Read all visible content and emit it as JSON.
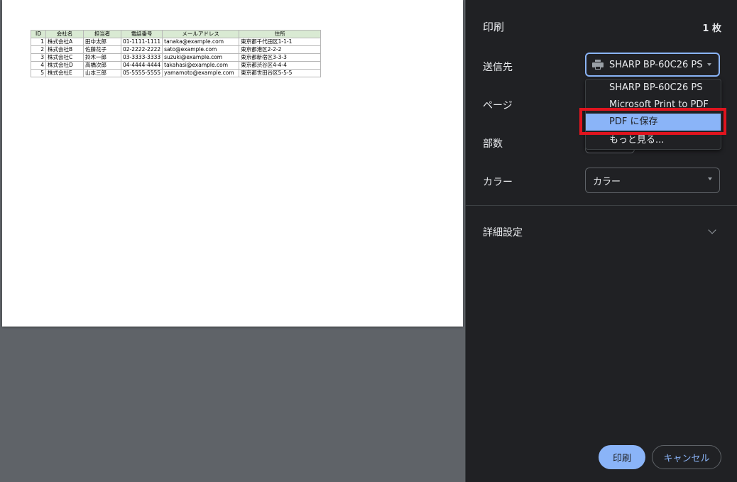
{
  "preview": {
    "table": {
      "headers": [
        "ID",
        "会社名",
        "担当者",
        "電話番号",
        "メールアドレス",
        "住所"
      ],
      "rows": [
        [
          "1",
          "株式会社A",
          "田中太郎",
          "01-1111-1111",
          "tanaka@example.com",
          "東京都千代田区1-1-1"
        ],
        [
          "2",
          "株式会社B",
          "佐藤花子",
          "02-2222-2222",
          "sato@example.com",
          "東京都港区2-2-2"
        ],
        [
          "3",
          "株式会社C",
          "鈴木一郎",
          "03-3333-3333",
          "suzuki@example.com",
          "東京都新宿区3-3-3"
        ],
        [
          "4",
          "株式会社D",
          "高橋次郎",
          "04-4444-4444",
          "takahasi@example.com",
          "東京都渋谷区4-4-4"
        ],
        [
          "5",
          "株式会社E",
          "山本三郎",
          "05-5555-5555",
          "yamamoto@example.com",
          "東京都世田谷区5-5-5"
        ]
      ],
      "header_color": "#d9ead3"
    }
  },
  "sidebar": {
    "title": "印刷",
    "sheet_count": "1 枚",
    "destination": {
      "label": "送信先",
      "value": "SHARP BP-60C26 PS",
      "icon": "printer-icon"
    },
    "pages": {
      "label": "ページ"
    },
    "copies": {
      "label": "部数"
    },
    "color": {
      "label": "カラー",
      "value": "カラー"
    },
    "advanced": {
      "label": "詳細設定",
      "icon": "chevron-down-icon"
    },
    "dropdown": {
      "items": [
        "SHARP BP-60C26 PS",
        "Microsoft Print to PDF",
        "PDF に保存",
        "もっと見る..."
      ],
      "selected": "PDF に保存"
    },
    "buttons": {
      "print": "印刷",
      "cancel": "キャンセル"
    }
  },
  "colors": {
    "accent": "#8ab4f8",
    "sidebar_bg": "#202124",
    "preview_bg": "#5f6368",
    "highlight": "#e0141e"
  }
}
